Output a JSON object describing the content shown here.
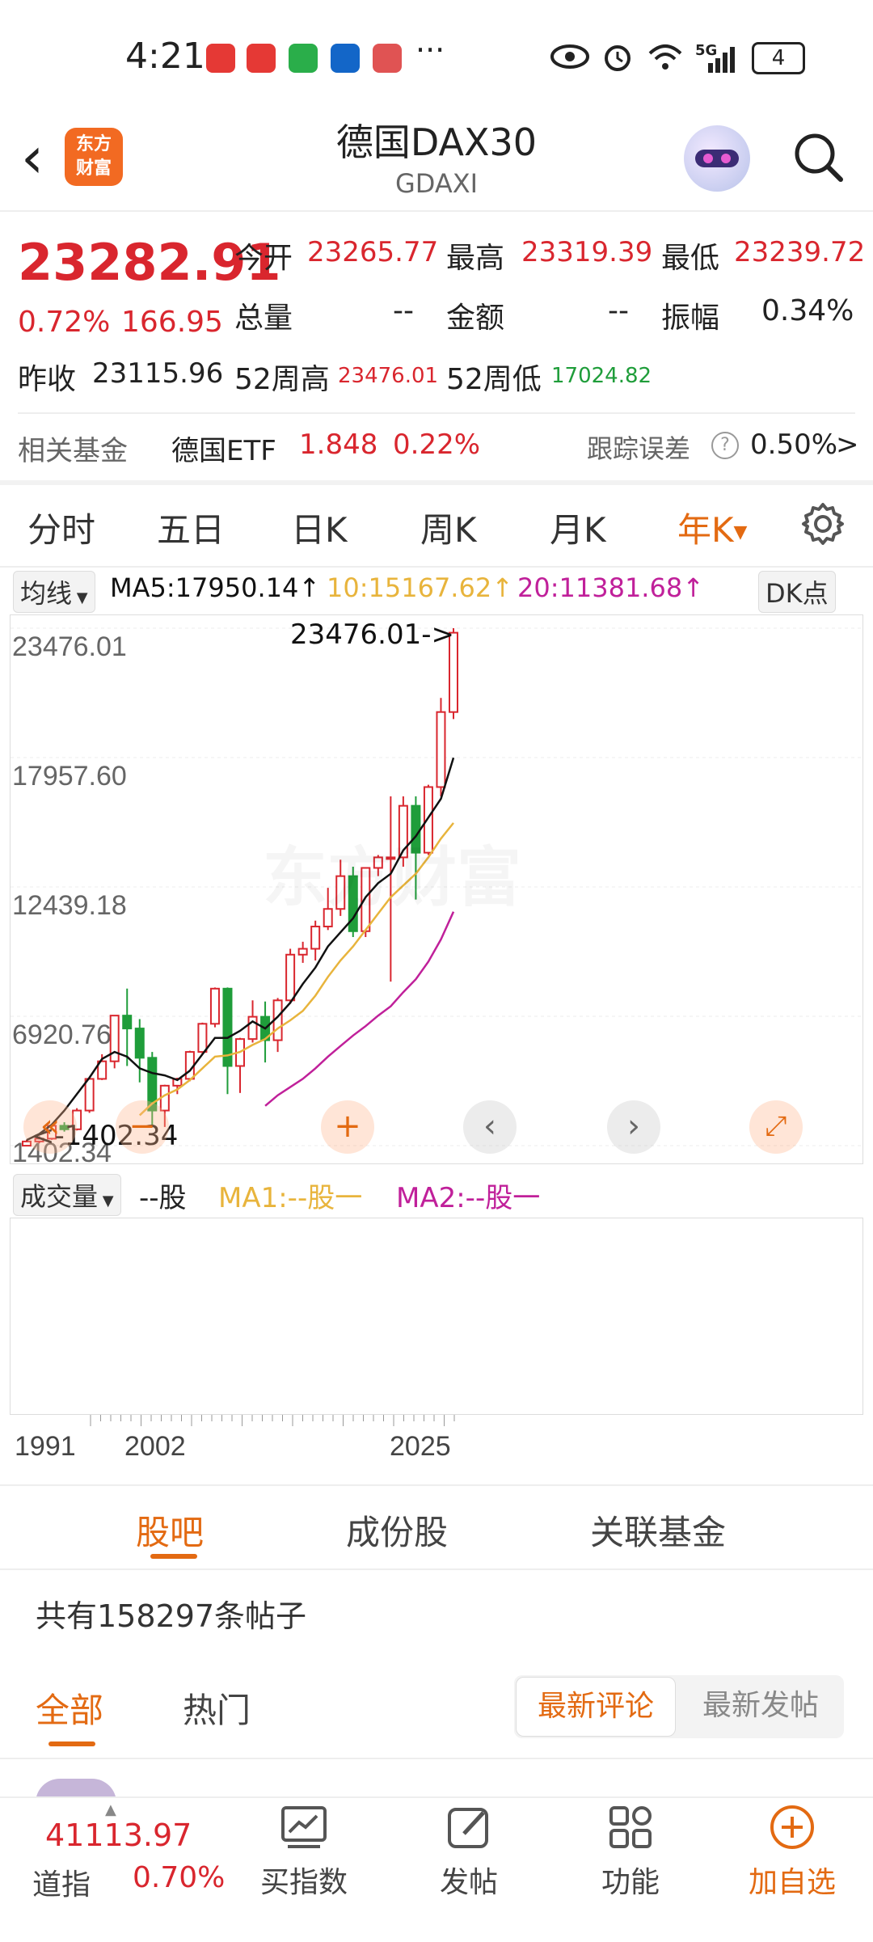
{
  "status": {
    "time": "4:21",
    "dots": "···",
    "network": "5G",
    "battery": "4"
  },
  "header": {
    "title": "德国DAX30",
    "code": "GDAXI",
    "logo_text_1": "东方",
    "logo_text_2": "财富"
  },
  "quote": {
    "price": "23282.91",
    "change_pct": "0.72%",
    "change_amt": "166.95",
    "open_label": "今开",
    "open": "23265.77",
    "high_label": "最高",
    "high": "23319.39",
    "low_label": "最低",
    "low": "23239.72",
    "volume_label": "总量",
    "volume": "--",
    "amount_label": "金额",
    "amount": "--",
    "amplitude_label": "振幅",
    "amplitude": "0.34%",
    "prev_close_label": "昨收",
    "prev_close": "23115.96",
    "w52_high_label": "52周高",
    "w52_high": "23476.01",
    "w52_low_label": "52周低",
    "w52_low": "17024.82"
  },
  "fund": {
    "label": "相关基金",
    "name": "德国ETF",
    "price": "1.848",
    "pct": "0.22%",
    "tracking_label": "跟踪误差",
    "tracking_value": "0.50%",
    "arrow": ">"
  },
  "ktabs": [
    "分时",
    "五日",
    "日K",
    "周K",
    "月K",
    "年K"
  ],
  "ktabs_active": "年K",
  "indicator": {
    "select": "均线",
    "ma5": "MA5:17950.14↑",
    "ma10": "10:15167.62↑",
    "ma20": "20:11381.68↑",
    "dk": "DK点"
  },
  "colors": {
    "up": "#d9262e",
    "down": "#1f9d3a",
    "accent": "#e36a12",
    "ma5": "#111111",
    "ma10": "#e8b43c",
    "ma20": "#c0209a"
  },
  "chart_data": {
    "type": "candlestick",
    "y_ticks": [
      "23476.01",
      "17957.60",
      "12439.18",
      "6920.76",
      "1402.34"
    ],
    "max_label": "23476.01->",
    "min_label": "<-1402.34",
    "x_ticks": [
      "1991",
      "2002",
      "2025"
    ],
    "ylim": [
      1402.34,
      23476.01
    ],
    "candles": [
      {
        "o": 1400,
        "h": 1650,
        "l": 1402.34,
        "c": 1580
      },
      {
        "o": 1580,
        "h": 1800,
        "l": 1500,
        "c": 1700
      },
      {
        "o": 1700,
        "h": 2300,
        "l": 1650,
        "c": 2250
      },
      {
        "o": 2250,
        "h": 2400,
        "l": 2000,
        "c": 2100
      },
      {
        "o": 2100,
        "h": 3000,
        "l": 2050,
        "c": 2900
      },
      {
        "o": 2900,
        "h": 4300,
        "l": 2800,
        "c": 4250
      },
      {
        "o": 4250,
        "h": 5300,
        "l": 4200,
        "c": 5000
      },
      {
        "o": 5000,
        "h": 6900,
        "l": 4700,
        "c": 6950
      },
      {
        "o": 6950,
        "h": 8100,
        "l": 4800,
        "c": 6400
      },
      {
        "o": 6400,
        "h": 6800,
        "l": 4100,
        "c": 5150
      },
      {
        "o": 5150,
        "h": 5400,
        "l": 2200,
        "c": 2900
      },
      {
        "o": 2900,
        "h": 4000,
        "l": 2200,
        "c": 3960
      },
      {
        "o": 3960,
        "h": 4300,
        "l": 3600,
        "c": 4250
      },
      {
        "o": 4250,
        "h": 5450,
        "l": 4150,
        "c": 5400
      },
      {
        "o": 5400,
        "h": 6650,
        "l": 5300,
        "c": 6600
      },
      {
        "o": 6600,
        "h": 8150,
        "l": 6450,
        "c": 8100
      },
      {
        "o": 8100,
        "h": 8150,
        "l": 3600,
        "c": 4800
      },
      {
        "o": 4800,
        "h": 6000,
        "l": 3650,
        "c": 5950
      },
      {
        "o": 5950,
        "h": 7600,
        "l": 5800,
        "c": 6900
      },
      {
        "o": 6900,
        "h": 7550,
        "l": 4950,
        "c": 5900
      },
      {
        "o": 5900,
        "h": 7700,
        "l": 5400,
        "c": 7600
      },
      {
        "o": 7600,
        "h": 9800,
        "l": 7450,
        "c": 9550
      },
      {
        "o": 9550,
        "h": 10100,
        "l": 9200,
        "c": 9800
      },
      {
        "o": 9800,
        "h": 11000,
        "l": 9300,
        "c": 10750
      },
      {
        "o": 10750,
        "h": 12400,
        "l": 10600,
        "c": 11500
      },
      {
        "o": 11500,
        "h": 13600,
        "l": 11200,
        "c": 12900
      },
      {
        "o": 12900,
        "h": 13300,
        "l": 10300,
        "c": 10550
      },
      {
        "o": 10550,
        "h": 13250,
        "l": 10300,
        "c": 13250
      },
      {
        "o": 13250,
        "h": 13800,
        "l": 12900,
        "c": 13700
      },
      {
        "o": 13700,
        "h": 16300,
        "l": 8400,
        "c": 13700
      },
      {
        "o": 13700,
        "h": 16300,
        "l": 13300,
        "c": 15900
      },
      {
        "o": 15900,
        "h": 16300,
        "l": 11900,
        "c": 13900
      },
      {
        "o": 13900,
        "h": 16800,
        "l": 13800,
        "c": 16700
      },
      {
        "o": 16700,
        "h": 20500,
        "l": 16300,
        "c": 19900
      },
      {
        "o": 19900,
        "h": 23476.01,
        "l": 19600,
        "c": 23282.91
      }
    ],
    "ma5": [
      1640,
      1900,
      2300,
      2900,
      3600,
      4300,
      5100,
      5400,
      5200,
      4700,
      4500,
      4400,
      4200,
      4600,
      5300,
      6000,
      6000,
      6300,
      6700,
      6400,
      6900,
      7500,
      8300,
      9000,
      9900,
      10500,
      11100,
      12000,
      12600,
      13000,
      14000,
      14600,
      15400,
      16200,
      17950.14
    ],
    "ma10": [
      null,
      null,
      null,
      null,
      null,
      null,
      null,
      null,
      null,
      2700,
      3200,
      3550,
      3800,
      4200,
      4700,
      5200,
      5250,
      5400,
      5700,
      5950,
      6400,
      6750,
      7150,
      7800,
      8600,
      9300,
      9900,
      10600,
      11300,
      12000,
      12500,
      13000,
      13700,
      14500,
      15167.62
    ],
    "ma20": [
      null,
      null,
      null,
      null,
      null,
      null,
      null,
      null,
      null,
      null,
      null,
      null,
      null,
      null,
      null,
      null,
      null,
      null,
      null,
      3100,
      3550,
      3900,
      4250,
      4700,
      5200,
      5650,
      6100,
      6500,
      6950,
      7350,
      7950,
      8500,
      9250,
      10200,
      11381.68
    ]
  },
  "volume": {
    "select": "成交量",
    "value": "--股",
    "ma1": "MA1:--股一",
    "ma2": "MA2:--股一"
  },
  "subtabs": [
    "股吧",
    "成份股",
    "关联基金"
  ],
  "subtabs_active": "股吧",
  "posts_count": "共有158297条帖子",
  "filter": {
    "all": "全部",
    "hot": "热门",
    "latest_comment": "最新评论",
    "latest_post": "最新发帖"
  },
  "bottom": {
    "index_value": "41113.97",
    "index_name": "道指",
    "index_pct": "0.70%",
    "buy_index": "买指数",
    "post": "发帖",
    "functions": "功能",
    "add_watch": "加自选"
  }
}
